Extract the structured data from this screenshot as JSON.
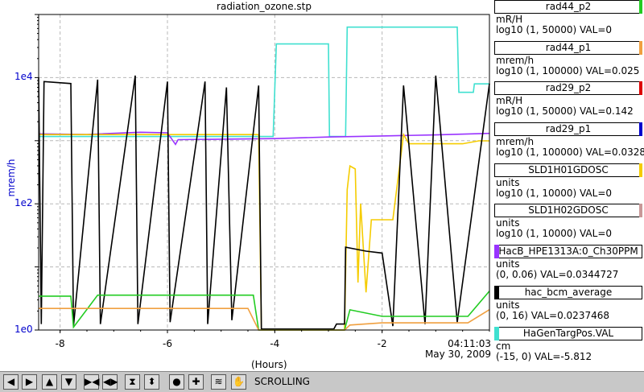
{
  "title": "radiation_ozone.stp",
  "y_axis_label": "mrem/h",
  "x_axis_label": "(Hours)",
  "now_time": "04:11:03",
  "now_date": "May 30, 2009",
  "toolbar": {
    "buttons": [
      "scroll-left",
      "scroll-right",
      "scroll-up",
      "scroll-down",
      "zoom-in-x",
      "zoom-out-x",
      "zoom-in-y",
      "zoom-out-y",
      "record",
      "crosshair",
      "autoscale",
      "hand"
    ],
    "status": "SCROLLING"
  },
  "legend": [
    {
      "name": "rad44_p2",
      "units": "mR/H",
      "range": "log10 (1, 50000) VAL=0",
      "color": "#22cc22"
    },
    {
      "name": "rad44_p1",
      "units": "mrem/h",
      "range": "log10 (1, 100000) VAL=0.025",
      "color": "#f0a040"
    },
    {
      "name": "rad29_p2",
      "units": "mR/H",
      "range": "log10 (1, 50000) VAL=0.142",
      "color": "#dd0000"
    },
    {
      "name": "rad29_p1",
      "units": "mrem/h",
      "range": "log10 (1, 100000) VAL=0.0328",
      "color": "#0000cc"
    },
    {
      "name": "SLD1H01GDOSC",
      "units": "units",
      "range": "log10 (1, 10000) VAL=0",
      "color": "#f5cc00"
    },
    {
      "name": "SLD1H02GDOSC",
      "units": "units",
      "range": "log10 (1, 10000) VAL=0",
      "color": "#c89898"
    },
    {
      "name": "HacB_HPE1313A:0_Ch30PPM",
      "units": "units",
      "range": "(0, 0.06) VAL=0.0344727",
      "color": "#9933ff"
    },
    {
      "name": "hac_bcm_average",
      "units": "units",
      "range": "(0, 16) VAL=0.0237468",
      "color": "#000000"
    },
    {
      "name": "HaGenTargPos.VAL",
      "units": "cm",
      "range": "(-15, 0) VAL=-5.812",
      "color": "#40e0d0"
    }
  ],
  "chart_data": {
    "type": "line",
    "title": "radiation_ozone.stp",
    "xlabel": "(Hours)",
    "ylabel": "mrem/h",
    "xlim": [
      -8.4,
      0
    ],
    "x_ticks": [
      -8,
      -6,
      -4,
      -2
    ],
    "y_scale": "log",
    "ylim": [
      1,
      100000
    ],
    "y_ticks": [
      {
        "value": 1,
        "label": "1e0"
      },
      {
        "value": 100,
        "label": "1e2"
      },
      {
        "value": 10000,
        "label": "1e4"
      }
    ],
    "grid": true,
    "series": [
      {
        "name": "HaGenTargPos.VAL",
        "color": "#40e0d0",
        "scale": [
          -15,
          0
        ],
        "x": [
          -8.4,
          -4.03,
          -3.97,
          -3.0,
          -2.98,
          -2.68,
          -2.65,
          -0.6,
          -0.57,
          -0.3,
          -0.28,
          0
        ],
        "y": [
          -5.8,
          -5.8,
          -1.4,
          -1.4,
          -5.8,
          -5.8,
          -0.6,
          -0.6,
          -3.7,
          -3.7,
          -3.3,
          -3.3
        ]
      },
      {
        "name": "HacB_HPE1313A:0_Ch30PPM",
        "color": "#9933ff",
        "scale": [
          0,
          0.06
        ],
        "x": [
          -8.4,
          -7.5,
          -6.5,
          -6.0,
          -5.85,
          -5.8,
          -4.0,
          -3.0,
          -2.0,
          -1.0,
          0
        ],
        "y": [
          0.0373,
          0.0372,
          0.0376,
          0.0375,
          0.0353,
          0.0362,
          0.0364,
          0.0367,
          0.0369,
          0.0371,
          0.0374
        ]
      },
      {
        "name": "SLD1H01GDOSC",
        "color": "#f5cc00",
        "scale": [
          1,
          10000
        ],
        "x": [
          -8.4,
          -7.0,
          -6.0,
          -5.0,
          -4.3,
          -4.25,
          -2.7,
          -2.65,
          -2.6,
          -2.5,
          -2.45,
          -2.4,
          -2.3,
          -2.2,
          -1.8,
          -1.6,
          -1.5,
          -1.0,
          -0.5,
          -0.2,
          0
        ],
        "y": [
          300,
          300,
          300,
          300,
          300,
          1,
          1,
          60,
          120,
          110,
          4,
          40,
          3,
          25,
          25,
          300,
          230,
          230,
          230,
          250,
          250
        ]
      },
      {
        "name": "hac_bcm_average",
        "color": "#000000",
        "scale": [
          0,
          16
        ],
        "x": [
          -8.4,
          -8.35,
          -8.3,
          -7.8,
          -7.75,
          -7.3,
          -7.25,
          -6.6,
          -6.55,
          -6.0,
          -5.95,
          -5.3,
          -5.25,
          -4.9,
          -4.8,
          -4.3,
          -4.25,
          -2.9,
          -2.85,
          -2.7,
          -2.68,
          -2.3,
          -2.0,
          -1.8,
          -1.6,
          -1.2,
          -1.0,
          -0.6,
          0
        ],
        "y": [
          12.8,
          0.3,
          12.6,
          12.5,
          0.2,
          12.7,
          0.3,
          12.9,
          0.3,
          12.6,
          0.4,
          12.6,
          0.3,
          12.3,
          0.5,
          12.4,
          0.05,
          0.05,
          0.3,
          0.3,
          4.2,
          4.0,
          3.9,
          0.2,
          12.4,
          0.3,
          12.9,
          0.4,
          12.5
        ]
      },
      {
        "name": "rad44_p2",
        "color": "#22cc22",
        "scale": [
          1,
          50000
        ],
        "x": [
          -8.4,
          -7.8,
          -7.75,
          -7.3,
          -6.5,
          -6.0,
          -5.3,
          -4.4,
          -4.3,
          -3.0,
          -2.7,
          -2.6,
          -2.0,
          -1.5,
          -1.0,
          -0.4,
          0
        ],
        "y": [
          3.2,
          3.2,
          1.1,
          3.3,
          3.3,
          3.3,
          3.3,
          3.3,
          1,
          1,
          1,
          2.0,
          1.6,
          1.6,
          1.6,
          1.6,
          3.8
        ]
      },
      {
        "name": "rad44_p1",
        "color": "#f0a040",
        "scale": [
          1,
          100000
        ],
        "x": [
          -8.4,
          -7.5,
          -6.5,
          -5.5,
          -4.8,
          -4.5,
          -4.3,
          -2.7,
          -2.6,
          -2.0,
          -1.5,
          -1.0,
          -0.4,
          0
        ],
        "y": [
          2.2,
          2.2,
          2.2,
          2.2,
          2.2,
          2.2,
          1,
          1,
          1.2,
          1.3,
          1.3,
          1.3,
          1.3,
          2.1
        ]
      }
    ]
  }
}
